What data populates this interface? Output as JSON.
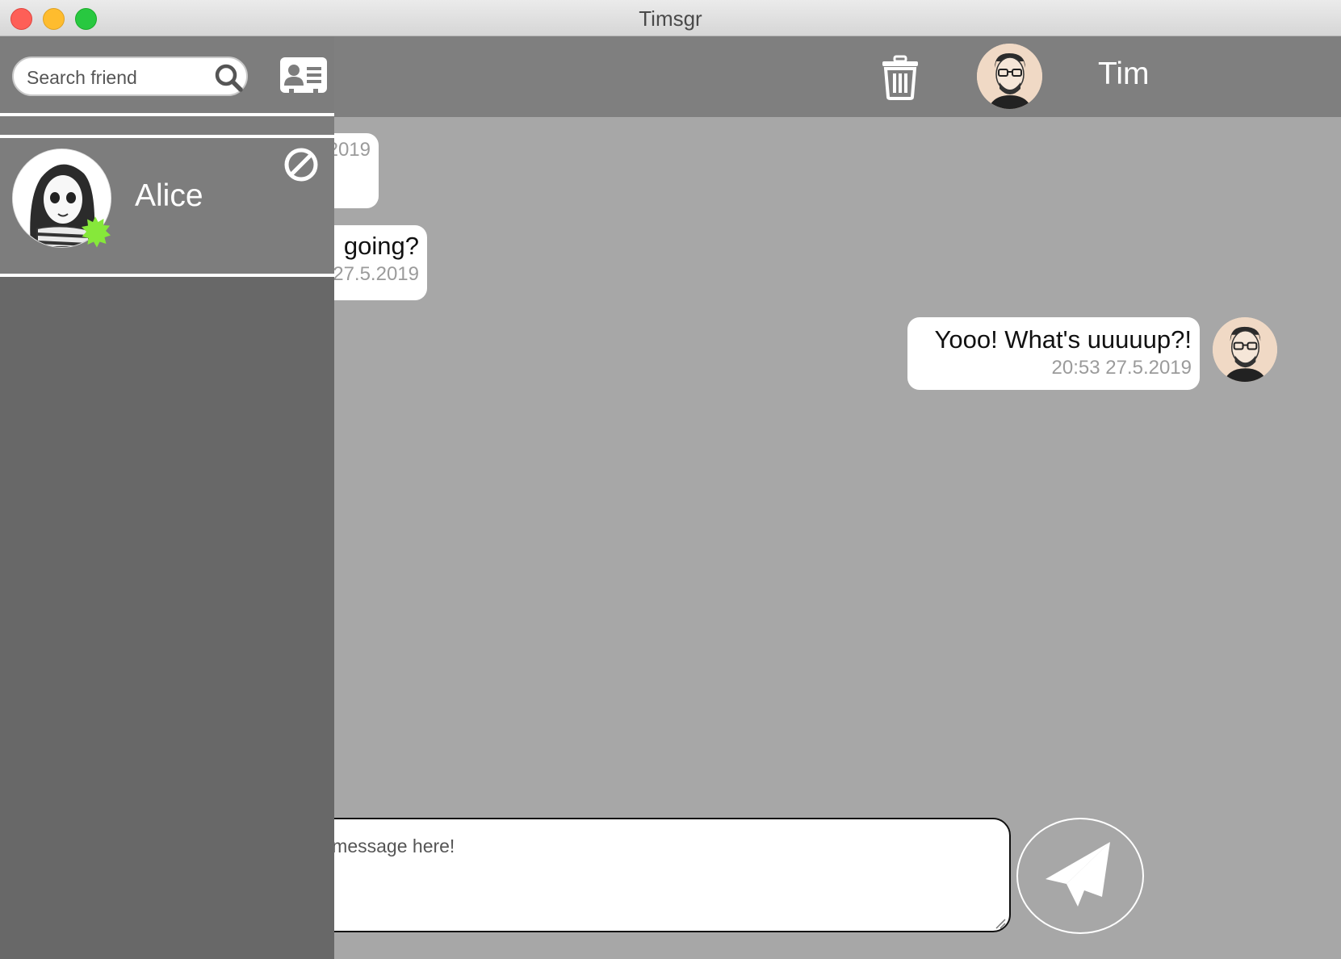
{
  "window": {
    "title": "Timsgr"
  },
  "sidebar": {
    "search": {
      "placeholder": "Search friend",
      "value": ""
    },
    "friends": [
      {
        "name": "Alice",
        "status": "online"
      }
    ]
  },
  "header": {
    "contact_name": "Tim"
  },
  "messages": [
    {
      "text": "",
      "timestamp": "2019"
    },
    {
      "text": "going?",
      "timestamp": "27.5.2019"
    },
    {
      "text": "Yooo! What's uuuuup?!",
      "timestamp": "20:53 27.5.2019"
    }
  ],
  "compose": {
    "placeholder": "e message here!",
    "value": ""
  },
  "colors": {
    "sidebar_bg": "#686868",
    "sidebar_item_bg": "#7d7d7d",
    "header_bg": "#7f7f7f",
    "chat_bg": "#a7a7a7",
    "online": "#86e83a",
    "timestamp": "#9b9b9b"
  },
  "icons": [
    "search-icon",
    "contacts-card-icon",
    "block-icon",
    "trash-icon",
    "send-icon",
    "online-status-icon"
  ]
}
